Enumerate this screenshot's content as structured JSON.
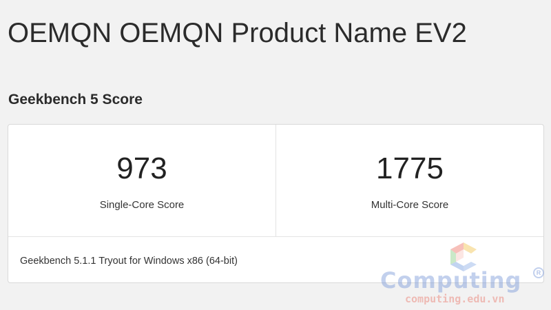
{
  "page": {
    "title": "OEMQN OEMQN Product Name EV2"
  },
  "section": {
    "title": "Geekbench 5 Score"
  },
  "scores": {
    "single_core": {
      "value": "973",
      "label": "Single-Core Score"
    },
    "multi_core": {
      "value": "1775",
      "label": "Multi-Core Score"
    }
  },
  "version": {
    "text": "Geekbench 5.1.1 Tryout for Windows x86 (64-bit)"
  },
  "watermark": {
    "brand": "Computing",
    "url": "computing.edu.vn",
    "colors": {
      "wordmark": "#7896d7",
      "url": "#eb8c82",
      "logo_red": "#f08c82",
      "logo_yellow": "#f5d27a",
      "logo_green": "#9fd79a",
      "logo_blue": "#8fb0e6"
    }
  }
}
